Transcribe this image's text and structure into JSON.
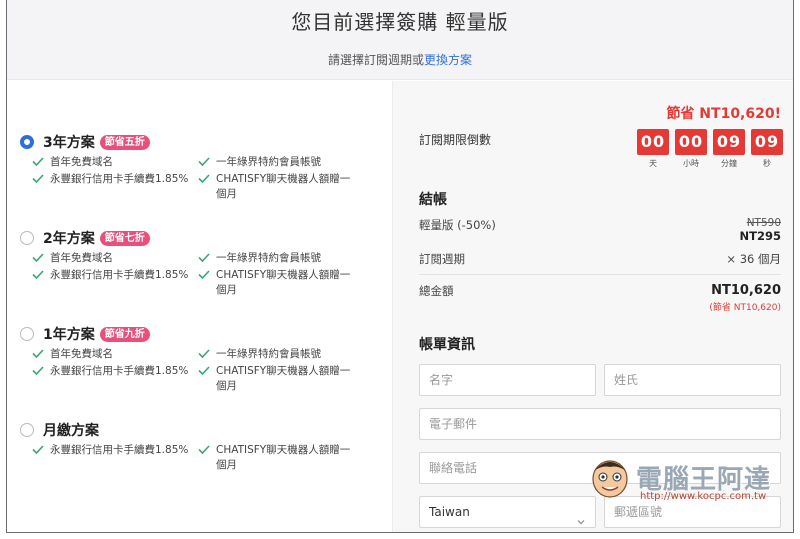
{
  "header": {
    "title": "您目前選擇簽購 輕量版",
    "subtitle_prefix": "請選擇訂閱週期或",
    "change_plan_link": "更換方案"
  },
  "plans": [
    {
      "name": "3年方案",
      "badge": "節省五折",
      "selected": true,
      "features": [
        "首年免費域名",
        "一年綠界特約會員帳號",
        "永豐銀行信用卡手續費1.85%",
        "CHATISFY聊天機器人額贈一",
        "個月"
      ]
    },
    {
      "name": "2年方案",
      "badge": "節省七折",
      "selected": false,
      "features": [
        "首年免費域名",
        "一年綠界特約會員帳號",
        "永豐銀行信用卡手續費1.85%",
        "CHATISFY聊天機器人額贈一",
        "個月"
      ]
    },
    {
      "name": "1年方案",
      "badge": "節省九折",
      "selected": false,
      "features": [
        "首年免費域名",
        "一年綠界特約會員帳號",
        "永豐銀行信用卡手續費1.85%",
        "CHATISFY聊天機器人額贈一",
        "個月"
      ]
    },
    {
      "name": "月繳方案",
      "badge": "",
      "selected": false,
      "features": [
        "永豐銀行信用卡手續費1.85%",
        "CHATISFY聊天機器人額贈一",
        "個月"
      ]
    }
  ],
  "summary": {
    "savings": "節省 NT10,620!",
    "countdown_label": "訂閱期限倒數",
    "countdown": [
      {
        "value": "00",
        "unit": "天"
      },
      {
        "value": "00",
        "unit": "小時"
      },
      {
        "value": "09",
        "unit": "分鐘"
      },
      {
        "value": "09",
        "unit": "秒"
      }
    ],
    "checkout_title": "結帳",
    "item_label": "輕量版 (-50%)",
    "item_original": "NT590",
    "item_price": "NT295",
    "cycle_label": "訂閱週期",
    "cycle_value": "× 36 個月",
    "total_label": "總金額",
    "total_value": "NT10,620",
    "total_saving": "(節省 NT10,620)"
  },
  "billing": {
    "title": "帳單資訊",
    "first_name_placeholder": "名字",
    "last_name_placeholder": "姓氏",
    "email_placeholder": "電子郵件",
    "phone_placeholder": "聯絡電話",
    "country_value": "Taiwan",
    "zip_placeholder": "郵遞區號"
  },
  "watermark": {
    "brand": "電腦王阿達",
    "url": "http://www.kocpc.com.tw"
  },
  "colors": {
    "accent_red": "#e53935",
    "badge_pink": "#e84f7a",
    "link_blue": "#2f6fd6",
    "check_green": "#3aa676"
  }
}
